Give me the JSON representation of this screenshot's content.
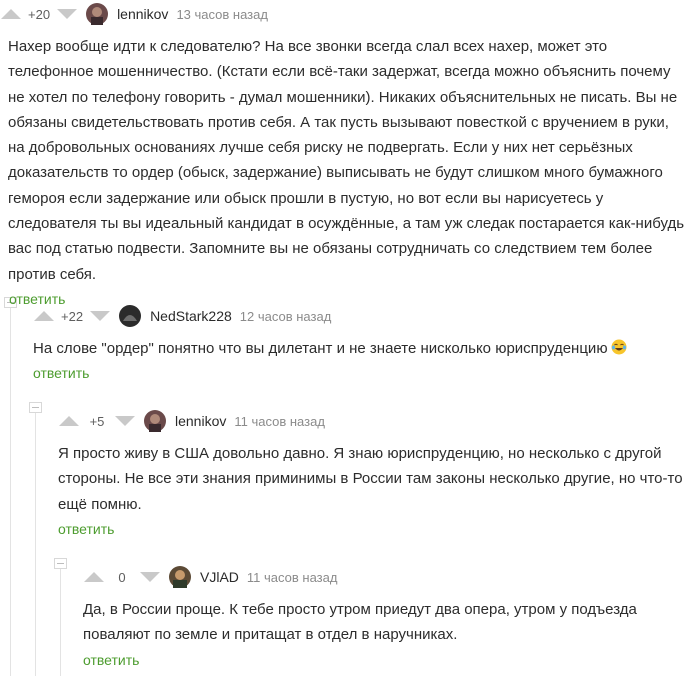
{
  "comments": [
    {
      "score": "+20",
      "author": "lennikov",
      "time": "13 часов назад",
      "text": "Нахер вообще идти к следователю? На все звонки всегда слал всех нахер, может это телефонное мошенничество. (Кстати если всё-таки задержат, всегда можно объяснить почему не хотел по телефону говорить - думал мошенники). Никаких объяснительных не писать. Вы не обязаны свидетельствовать против себя. А так пусть вызывают повесткой с вручением в руки, на добровольных основаниях лучше себя риску не подвергать. Если у них нет серьёзных доказательств то ордер (обыск, задержание) выписывать не будут слишком много бумажного гемороя если задержание или обыск прошли в пустую, но вот если вы нарисуетесь у следователя ты вы идеальный кандидат в осуждённые, а там уж следак постарается как-нибудь вас под статью подвести. Запомните вы не обязаны сотрудничать со следствием тем более против себя.",
      "reply": "ответить"
    },
    {
      "score": "+22",
      "author": "NedStark228",
      "time": "12 часов назад",
      "text": "На слове \"ордер\" понятно что вы дилетант и не знаете нисколько юриспруденцию",
      "emoji": "face-with-tears-of-joy-emoji",
      "reply": "ответить"
    },
    {
      "score": "+5",
      "author": "lennikov",
      "time": "11 часов назад",
      "text": "Я просто живу в США довольно давно. Я знаю юриспруденцию, но несколько с другой стороны. Не все эти знания приминимы в России там законы несколько другие, но что-то ещё помню.",
      "reply": "ответить"
    },
    {
      "score": "0",
      "author": "VJlAD",
      "time": "11 часов назад",
      "text": "Да, в России проще. К тебе просто утром приедут два опера, утром у подъезда поваляют по земле и притащат в отдел в наручниках.",
      "reply": "ответить"
    }
  ],
  "colors": {
    "reply": "#4c9c2e",
    "meta": "#8b8b8b",
    "arrow": "#c9c9c9",
    "branch": "#e3e3e3"
  }
}
